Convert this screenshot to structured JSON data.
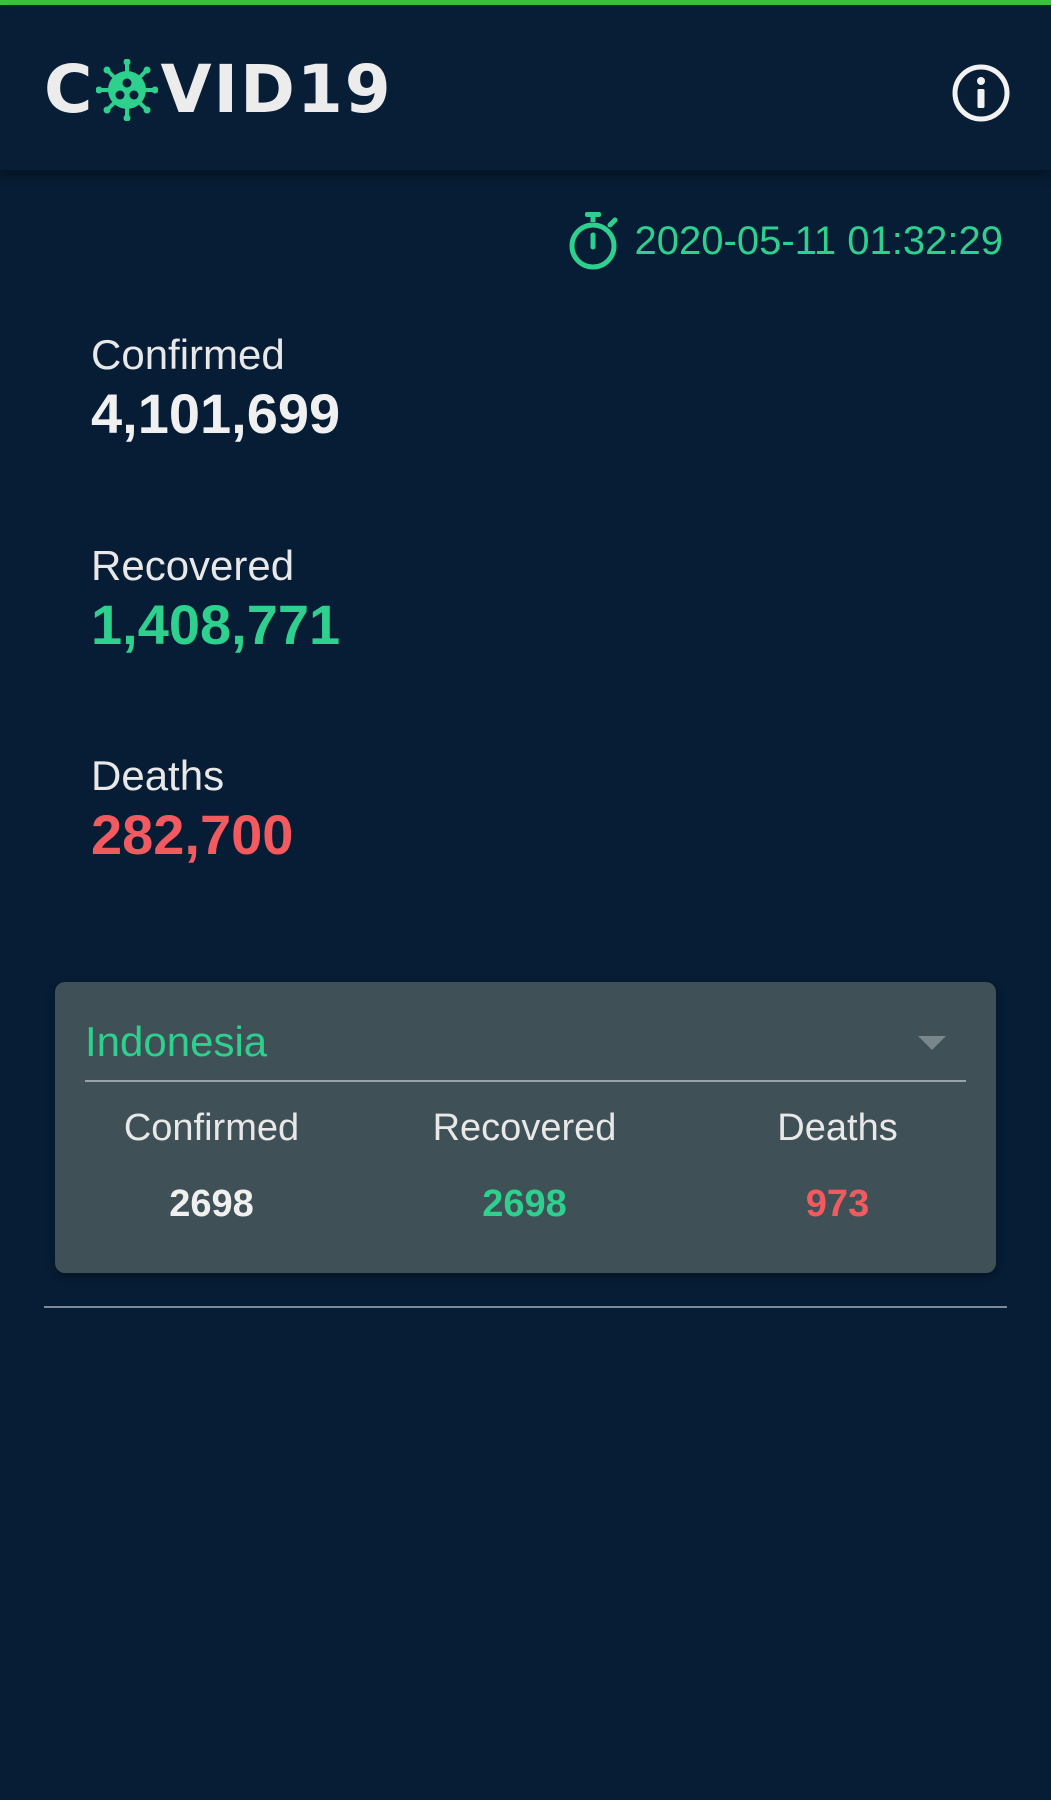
{
  "app": {
    "logo_text_left": "C",
    "logo_text_right": "VID19",
    "logo_icon": "virus-icon",
    "info_icon": "info-icon"
  },
  "updated": {
    "icon": "stopwatch-icon",
    "timestamp": "2020-05-11 01:32:29"
  },
  "global": {
    "confirmed_label": "Confirmed",
    "confirmed_value": "4,101,699",
    "recovered_label": "Recovered",
    "recovered_value": "1,408,771",
    "deaths_label": "Deaths",
    "deaths_value": "282,700"
  },
  "country": {
    "selected": "Indonesia",
    "confirmed_label": "Confirmed",
    "confirmed_value": "2698",
    "recovered_label": "Recovered",
    "recovered_value": "2698",
    "deaths_label": "Deaths",
    "deaths_value": "973"
  },
  "colors": {
    "background": "#071d35",
    "accent_green": "#2ed08e",
    "deaths_red": "#f25a5f",
    "card": "#3f5157",
    "top_bar": "#3cc43c"
  }
}
